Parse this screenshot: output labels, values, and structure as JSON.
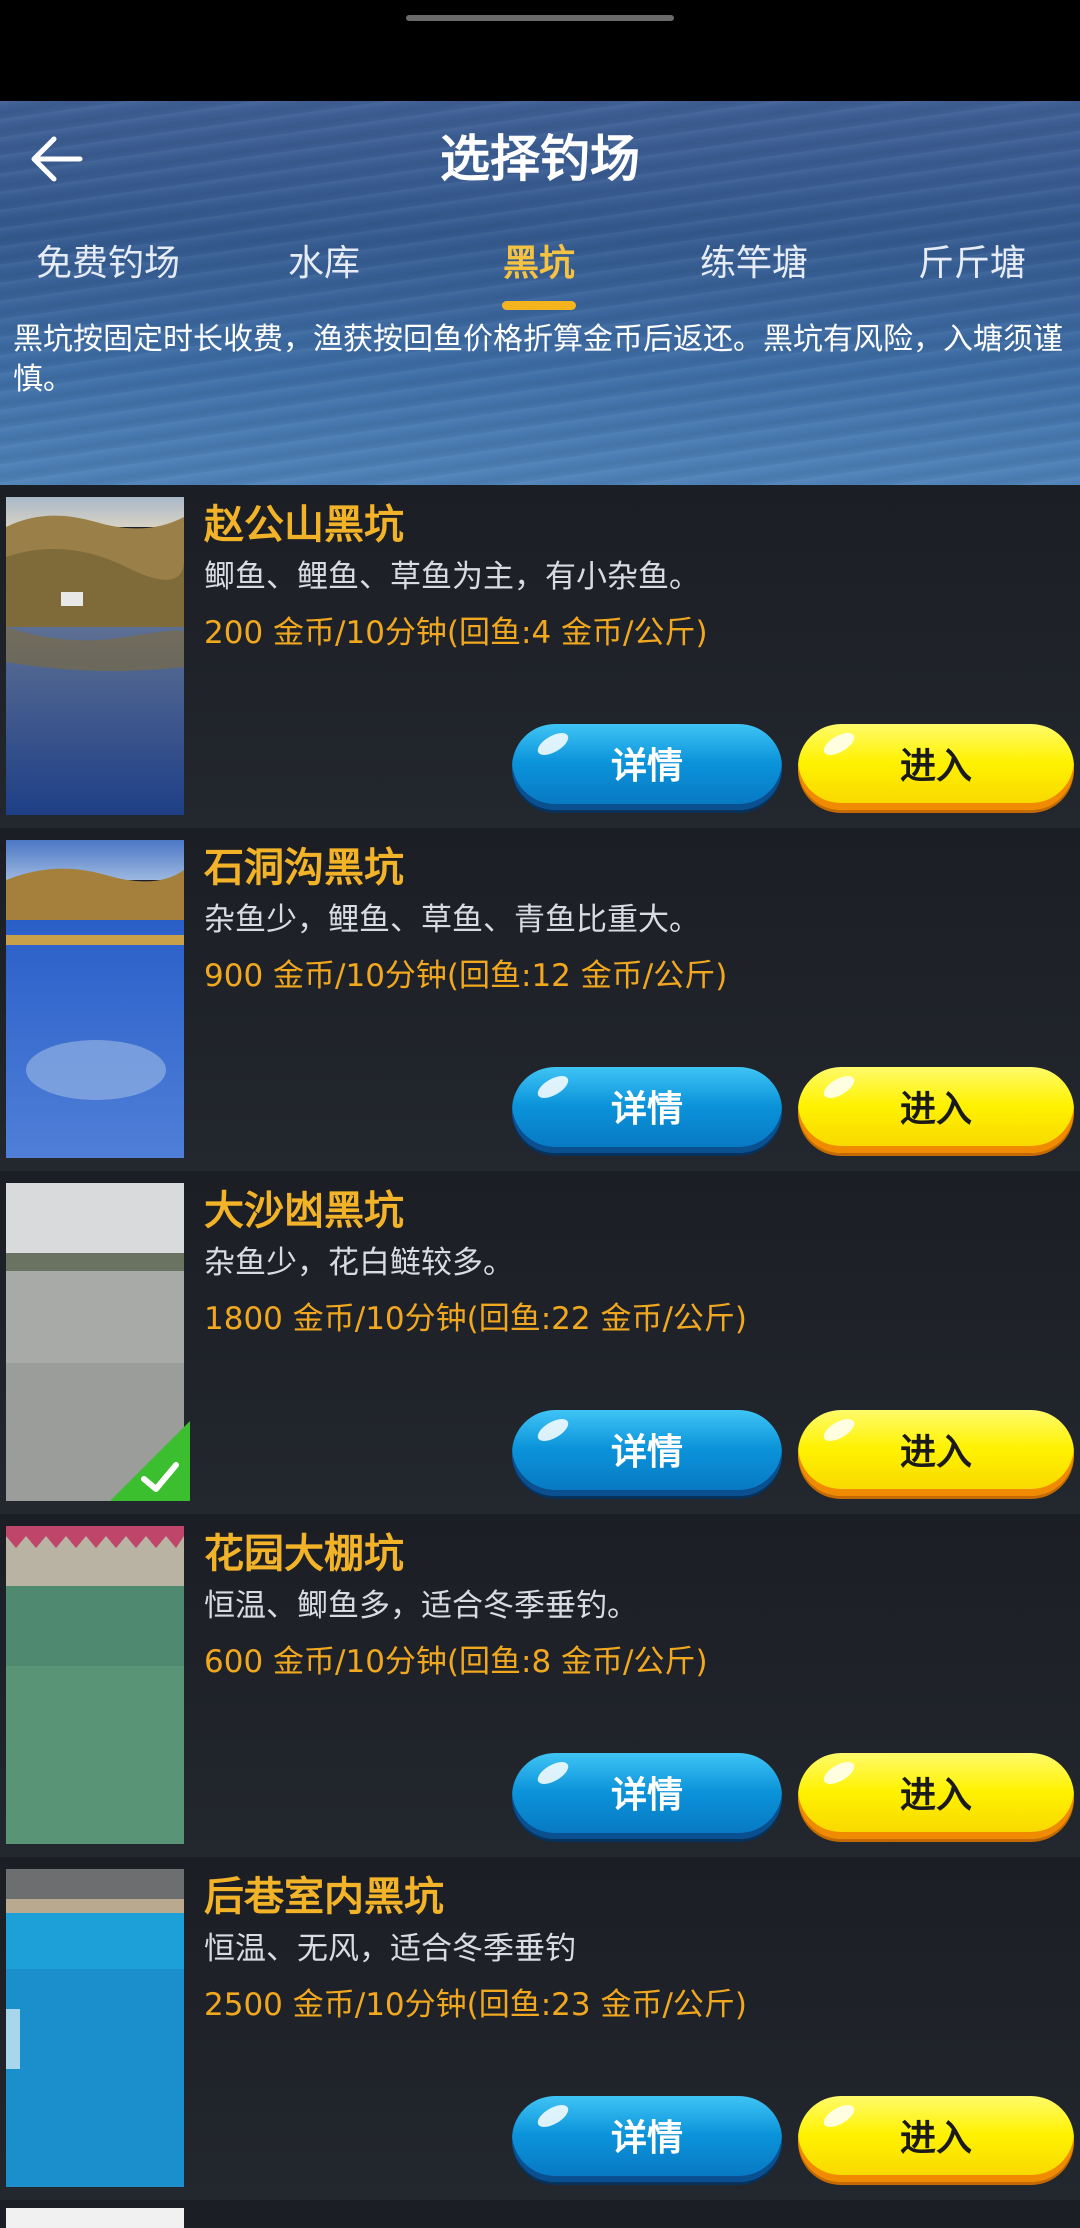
{
  "header": {
    "title": "选择钓场",
    "tabs": [
      {
        "label": "免费钓场",
        "active": false
      },
      {
        "label": "水库",
        "active": false
      },
      {
        "label": "黑坑",
        "active": true
      },
      {
        "label": "练竿塘",
        "active": false
      },
      {
        "label": "斤斤塘",
        "active": false
      }
    ],
    "notice": "黑坑按固定时长收费，渔获按回鱼价格折算金币后返还。黑坑有风险，入塘须谨慎。"
  },
  "buttons": {
    "detail_label": "详情",
    "enter_label": "进入"
  },
  "venues": [
    {
      "name": "赵公山黑坑",
      "desc": "鲫鱼、鲤鱼、草鱼为主，有小杂鱼。",
      "price": "200 金币/10分钟(回鱼:4 金币/公斤)",
      "selected": false
    },
    {
      "name": "石洞沟黑坑",
      "desc": "杂鱼少，鲤鱼、草鱼、青鱼比重大。",
      "price": "900 金币/10分钟(回鱼:12 金币/公斤)",
      "selected": false
    },
    {
      "name": "大沙凼黑坑",
      "desc": "杂鱼少，花白鲢较多。",
      "price": "1800 金币/10分钟(回鱼:22 金币/公斤)",
      "selected": true
    },
    {
      "name": "花园大棚坑",
      "desc": "恒温、鲫鱼多，适合冬季垂钓。",
      "price": "600 金币/10分钟(回鱼:8 金币/公斤)",
      "selected": false
    },
    {
      "name": "后巷室内黑坑",
      "desc": "恒温、无风，适合冬季垂钓",
      "price": "2500 金币/10分钟(回鱼:23 金币/公斤)",
      "selected": false
    }
  ],
  "colors": {
    "accent_title": "#f3b328",
    "price": "#f1a81f",
    "detail_button": "#0b93da",
    "enter_button": "#fff200",
    "selected_badge": "#3bbf2e"
  }
}
